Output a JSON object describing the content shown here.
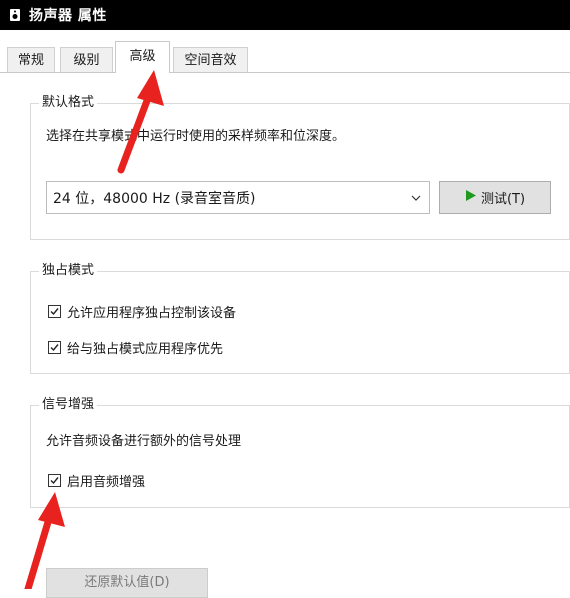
{
  "window": {
    "title": "扬声器 属性"
  },
  "tabs": [
    {
      "label": "常规"
    },
    {
      "label": "级别"
    },
    {
      "label": "高级",
      "active": true
    },
    {
      "label": "空间音效"
    }
  ],
  "default_format": {
    "legend": "默认格式",
    "description": "选择在共享模式中运行时使用的采样频率和位深度。",
    "selected_format": "24 位，48000 Hz (录音室音质)",
    "test_button_label": "测试(T)"
  },
  "exclusive_mode": {
    "legend": "独占模式",
    "options": [
      {
        "label": "允许应用程序独占控制该设备",
        "checked": true
      },
      {
        "label": "给与独占模式应用程序优先",
        "checked": true
      }
    ]
  },
  "signal_enhancement": {
    "legend": "信号增强",
    "description": "允许音频设备进行额外的信号处理",
    "option": {
      "label": "启用音频增强",
      "checked": true
    }
  },
  "footer": {
    "restore_defaults_label": "还原默认值(D)"
  },
  "colors": {
    "annotation_arrow": "#e8231f",
    "play_icon": "#1f9a1f"
  }
}
